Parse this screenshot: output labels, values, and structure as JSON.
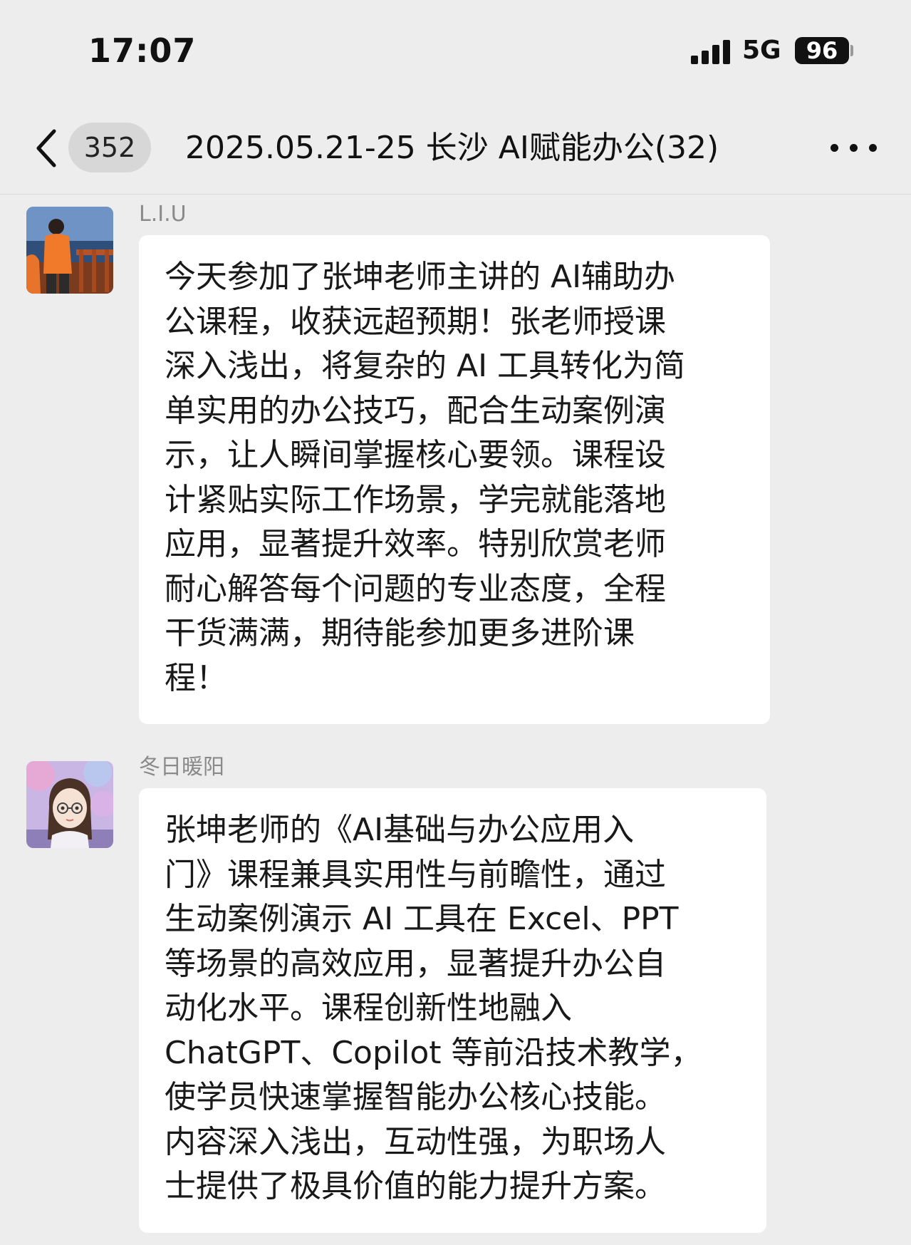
{
  "status_bar": {
    "time": "17:07",
    "network": "5G",
    "battery": "96",
    "icons": [
      "signal-bars-icon",
      "battery-icon"
    ]
  },
  "nav_bar": {
    "unread_count": "352",
    "title": "2025.05.21-25 长沙 AI赋能办公(32)",
    "icons": [
      "chevron-left-icon",
      "more-dots-icon"
    ]
  },
  "messages": [
    {
      "sender": "L.I.U",
      "text": "今天参加了张坤老师主讲的 AI辅助办\n公课程，收获远超预期！张老师授课\n深入浅出，将复杂的 AI 工具转化为简\n单实用的办公技巧，配合生动案例演\n示，让人瞬间掌握核心要领。课程设\n计紧贴实际工作场景，学完就能落地\n应用，显著提升效率。特别欣赏老师\n耐心解答每个问题的专业态度，全程\n干货满满，期待能参加更多进阶课\n程！"
    },
    {
      "sender": "冬日暖阳",
      "text": "张坤老师的《AI基础与办公应用入\n门》课程兼具实用性与前瞻性，通过\n生动案例演示 AI 工具在 Excel、PPT\n等场景的高效应用，显著提升办公自\n动化水平。课程创新性地融入\nChatGPT、Copilot 等前沿技术教学，\n使学员快速掌握智能办公核心技能。\n内容深入浅出，互动性强，为职场人\n士提供了极具价值的能力提升方案。"
    }
  ],
  "colors": {
    "background": "#ededed",
    "bubble": "#ffffff",
    "sender_name": "#8a8a8a",
    "text": "#191919"
  }
}
